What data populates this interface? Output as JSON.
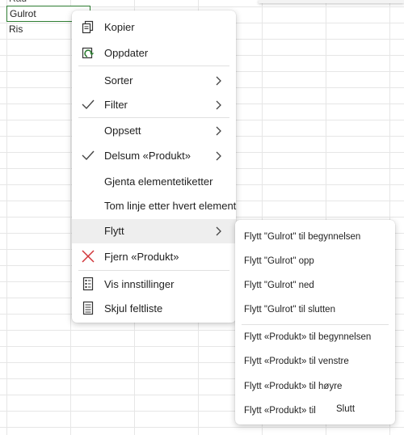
{
  "sheet": {
    "cells": {
      "top": "Rad",
      "gulrot": "Gulrot",
      "ris": "Ris"
    }
  },
  "context_menu": {
    "items": [
      {
        "label": "Kopier",
        "icon": "copy-icon"
      },
      {
        "label": "Oppdater",
        "icon": "refresh-icon"
      },
      {
        "label": "Sorter",
        "submenu": true
      },
      {
        "label": "Filter",
        "submenu": true,
        "checked": true
      },
      {
        "label": "Oppsett",
        "submenu": true
      },
      {
        "label": "Delsum «Produkt»",
        "submenu": true,
        "checked": true
      },
      {
        "label": "Gjenta elementetiketter"
      },
      {
        "label": "Tom linje etter hvert element"
      },
      {
        "label": "Flytt",
        "submenu": true,
        "active": true
      },
      {
        "label": "Fjern «Produkt»",
        "icon": "remove-icon"
      },
      {
        "label": "Vis innstillinger",
        "icon": "settings-list-icon"
      },
      {
        "label": "Skjul feltliste",
        "icon": "field-list-icon"
      }
    ]
  },
  "move_submenu": {
    "items": [
      {
        "label": "Flytt \"Gulrot\" til begynnelsen"
      },
      {
        "label": "Flytt \"Gulrot\" opp"
      },
      {
        "label": "Flytt \"Gulrot\" ned"
      },
      {
        "label": "Flytt \"Gulrot\" til slutten"
      },
      {
        "label": "Flytt «Produkt» til begynnelsen"
      },
      {
        "label": "Flytt «Produkt» til venstre"
      },
      {
        "label": "Flytt «Produkt» til høyre"
      },
      {
        "label": "Flytt «Produkt» til",
        "extra": "Slutt"
      }
    ]
  },
  "colors": {
    "accent_green": "#2e7d32",
    "remove_red": "#d13438",
    "check": "#444444"
  }
}
